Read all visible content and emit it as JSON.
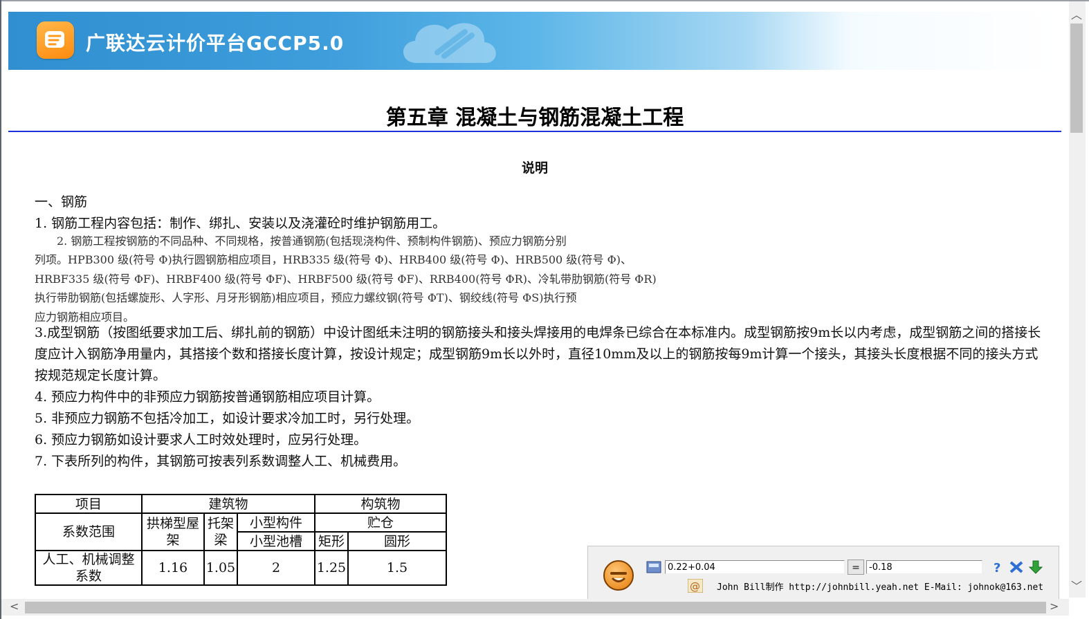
{
  "banner": {
    "title": "广联达云计价平台GCCP5.0"
  },
  "chapter": {
    "title": "第五章  混凝土与钢筋混凝土工程"
  },
  "section": {
    "heading": "说明"
  },
  "content": {
    "heading": "一、钢筋",
    "item1": "1. 钢筋工程内容包括：制作、绑扎、安装以及浇灌砼时维护钢筋用工。",
    "item2_lines": [
      "　　2. 钢筋工程按钢筋的不同品种、不同规格，按普通钢筋(包括现浇构件、预制构件钢筋)、预应力钢筋分别",
      "列项。HPB300 级(符号 Φ)执行圆钢筋相应项目，HRB335 级(符号 Φ)、HRB400 级(符号 Φ)、HRB500 级(符号 Φ)、",
      "HRBF335 级(符号 ΦF)、HRBF400 级(符号 ΦF)、HRBF500 级(符号 ΦF)、RRB400(符号 ΦR)、冷轧带肋钢筋(符号 ΦR)",
      "执行带肋钢筋(包括螺旋形、人字形、月牙形钢筋)相应项目，预应力螺纹钢(符号 ΦT)、钢绞线(符号 ΦS)执行预",
      "应力钢筋相应项目。"
    ],
    "item3": "3.成型钢筋（按图纸要求加工后、绑扎前的钢筋）中设计图纸未注明的钢筋接头和接头焊接用的电焊条已综合在本标准内。成型钢筋按9m长以内考虑，成型钢筋之间的搭接长度应计入钢筋净用量内，其搭接个数和搭接长度计算，按设计规定；成型钢筋9m长以外时，直径10mm及以上的钢筋按每9m计算一个接头，其接头长度根据不同的接头方式按规范规定长度计算。",
    "item4": "4. 预应力构件中的非预应力钢筋按普通钢筋相应项目计算。",
    "item5": "5. 非预应力钢筋不包括冷加工，如设计要求冷加工时，另行处理。",
    "item6": "6. 预应力钢筋如设计要求人工时效处理时，应另行处理。",
    "item7": "7. 下表所列的构件，其钢筋可按表列系数调整人工、机械费用。"
  },
  "table": {
    "h_item": "项目",
    "h_building": "建筑物",
    "h_structure": "构筑物",
    "h_range": "系数范围",
    "c_arch_truss": "拱梯型屋架",
    "c_truss_beam": "托架梁",
    "c_small_member": "小型构件",
    "c_silo": "贮仓",
    "c_small_pool": "小型池槽",
    "c_rect": "矩形",
    "c_round": "圆形",
    "r_label": "人工、机械调整系数",
    "values": [
      "1.16",
      "1.05",
      "2",
      "1.25",
      "1.5"
    ]
  },
  "calculator": {
    "expression": "0.22+0.04",
    "equals": "=",
    "result": "-0.18",
    "credit": "John Bill制作 http://johnbill.yeah.net E-Mail: johnok@163.net"
  }
}
